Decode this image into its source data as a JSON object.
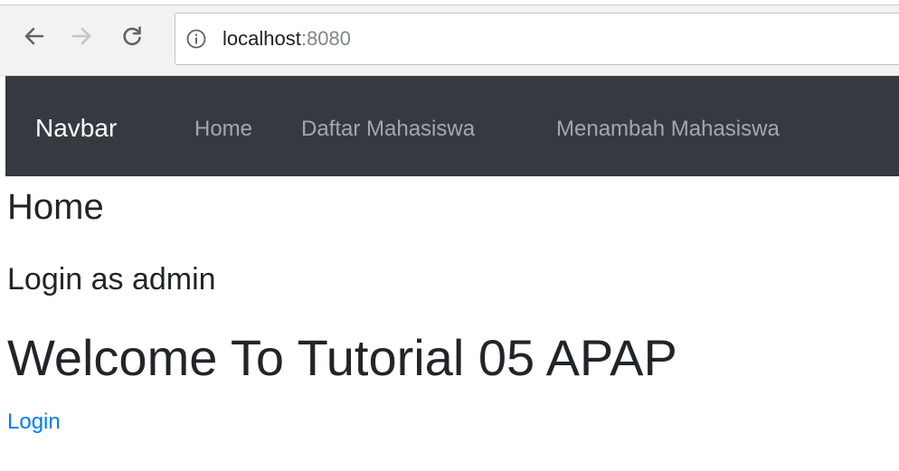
{
  "browser": {
    "url_host": "localhost",
    "url_port": ":8080",
    "icons": {
      "back": "arrow-left-icon",
      "forward": "arrow-right-icon",
      "reload": "reload-icon",
      "info": "info-icon"
    }
  },
  "navbar": {
    "brand": "Navbar",
    "links": [
      {
        "label": "Home"
      },
      {
        "label": "Daftar Mahasiswa"
      },
      {
        "label": "Menambah Mahasiswa"
      }
    ],
    "background_color": "#343a40"
  },
  "main": {
    "title": "Home",
    "login_status": "Login as admin",
    "welcome": "Welcome To Tutorial 05 APAP",
    "login_link": "Login"
  },
  "colors": {
    "link": "#007bff",
    "text": "#212529"
  }
}
